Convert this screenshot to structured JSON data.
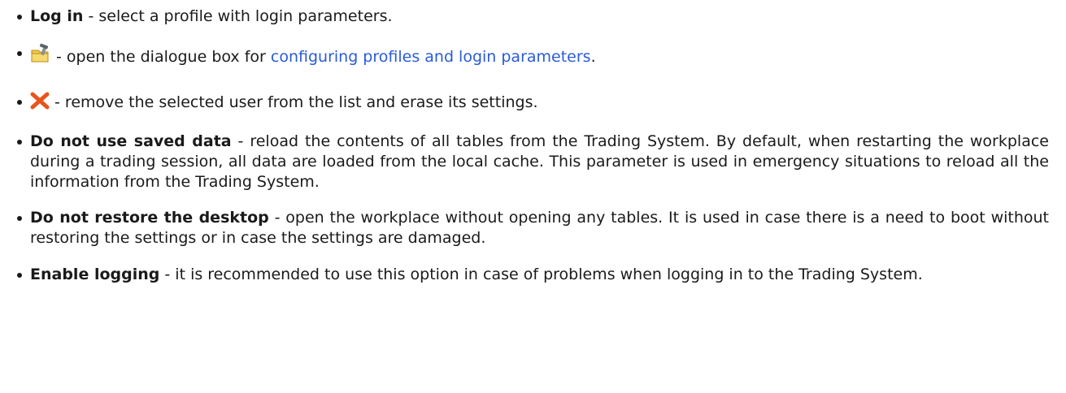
{
  "items": [
    {
      "term": "Log in",
      "text": " - select a profile with login parameters."
    },
    {
      "icon": "profile-settings-icon",
      "text_before_link": " - open the dialogue box for ",
      "link_text": "configuring profiles and login parameters",
      "text_after_link": "."
    },
    {
      "icon": "remove-icon",
      "text": " - remove the selected user from the list and erase its settings."
    },
    {
      "term": "Do not use saved data",
      "text": " - reload the contents of all tables from the Trading System. By default, when restarting the workplace during a trading session, all data are loaded from the local cache. This parameter is used in emergency situations to reload all the information from the Trading System."
    },
    {
      "term": "Do not restore the desktop",
      "text": " - open the workplace without opening any tables. It is used in case there is a need to boot without restoring the settings or in case the settings are damaged."
    },
    {
      "term": "Enable logging",
      "text": " - it is recommended to use this option in case of problems when logging in to the Trading System."
    }
  ],
  "colors": {
    "text": "#1a1a1a",
    "link": "#2a5bd7",
    "remove_icon": "#e8541e"
  }
}
